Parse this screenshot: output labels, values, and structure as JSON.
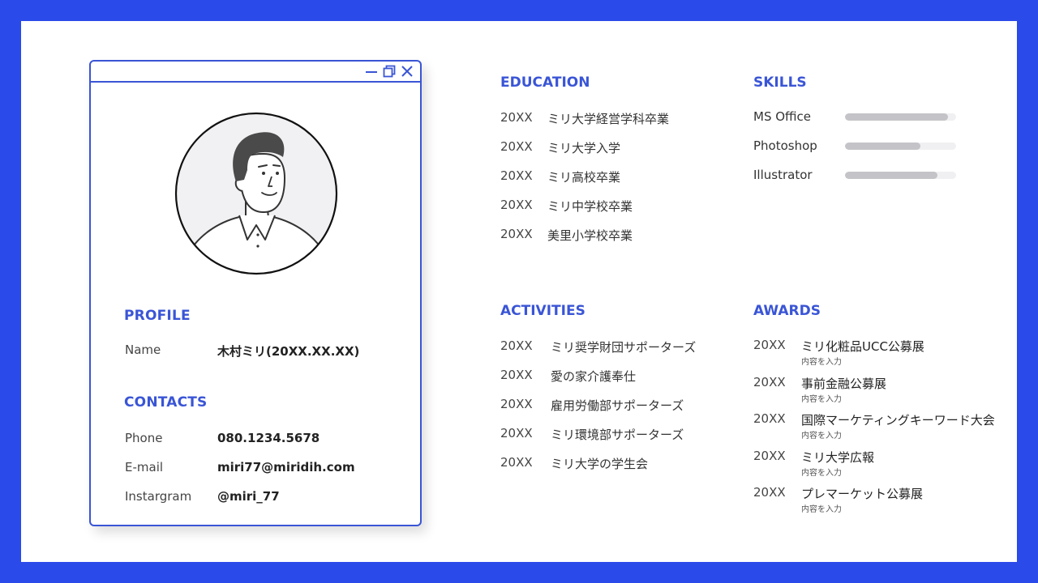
{
  "profile": {
    "heading": "PROFILE",
    "name_label": "Name",
    "name_value": "木村ミリ(20XX.XX.XX)"
  },
  "contacts": {
    "heading": "CONTACTS",
    "items": [
      {
        "label": "Phone",
        "value": "080.1234.5678"
      },
      {
        "label": "E-mail",
        "value": "miri77@miridih.com"
      },
      {
        "label": "Instargram",
        "value": "@miri_77"
      }
    ]
  },
  "education": {
    "heading": "EDUCATION",
    "items": [
      {
        "year": "20XX",
        "text": "ミリ大学経営学科卒業"
      },
      {
        "year": "20XX",
        "text": "ミリ大学入学"
      },
      {
        "year": "20XX",
        "text": "ミリ高校卒業"
      },
      {
        "year": "20XX",
        "text": "ミリ中学校卒業"
      },
      {
        "year": "20XX",
        "text": "美里小学校卒業"
      }
    ]
  },
  "skills": {
    "heading": "SKILLS",
    "items": [
      {
        "name": "MS Office",
        "level": 0.93
      },
      {
        "name": "Photoshop",
        "level": 0.68
      },
      {
        "name": "Illustrator",
        "level": 0.83
      }
    ]
  },
  "activities": {
    "heading": "ACTIVITIES",
    "items": [
      {
        "year": "20XX",
        "text": "ミリ奨学財団サポーターズ"
      },
      {
        "year": "20XX",
        "text": "愛の家介護奉仕"
      },
      {
        "year": "20XX",
        "text": "雇用労働部サポーターズ"
      },
      {
        "year": "20XX",
        "text": "ミリ環境部サポーターズ"
      },
      {
        "year": "20XX",
        "text": "ミリ大学の学生会"
      }
    ]
  },
  "awards": {
    "heading": "AWARDS",
    "items": [
      {
        "year": "20XX",
        "text": "ミリ化粧品UCC公募展",
        "sub": "内容を入力"
      },
      {
        "year": "20XX",
        "text": "事前金融公募展",
        "sub": "内容を入力"
      },
      {
        "year": "20XX",
        "text": "国際マーケティングキーワード大会",
        "sub": "内容を入力"
      },
      {
        "year": "20XX",
        "text": "ミリ大学広報",
        "sub": "内容を入力"
      },
      {
        "year": "20XX",
        "text": "プレマーケット公募展",
        "sub": "内容を入力"
      }
    ]
  },
  "colors": {
    "background": "#2b4aea",
    "accent": "#3a55d6",
    "skill_fill": "#c4c4c8",
    "skill_track": "#f0f0f2"
  },
  "icons": [
    "minimize-icon",
    "restore-icon",
    "close-icon",
    "avatar-illustration"
  ]
}
